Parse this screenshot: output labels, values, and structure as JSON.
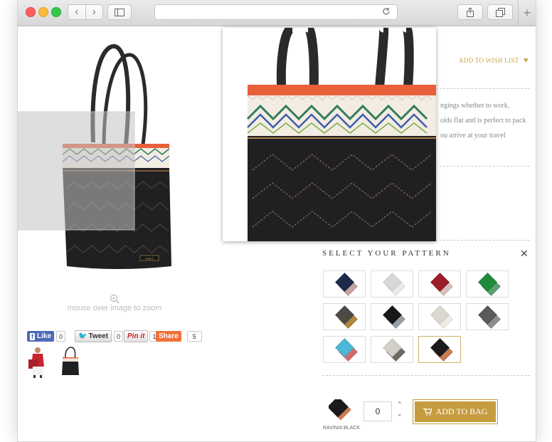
{
  "product": {
    "zoom_hint": "mouse over image to zoom",
    "add_to_wishlist": "ADD TO WISH LIST",
    "description": [
      "ngings whether to work,",
      "olds flat and is perfect to pack",
      "ou arrive at your travel"
    ],
    "tag_label": "cinda b"
  },
  "social": {
    "like_label": "Like",
    "like_count": "0",
    "tweet_label": "Tweet",
    "tweet_count": "0",
    "pin_label": "Pin it",
    "pin_count": "1",
    "share_label": "Share",
    "share_count": "5"
  },
  "patterns": {
    "title": "SELECT YOUR PATTERN",
    "close_glyph": "✕",
    "swatches": [
      {
        "a": "#1f2a4a",
        "b": "#c6a3a0"
      },
      {
        "a": "#d8d8d6",
        "b": "#ebebea"
      },
      {
        "a": "#9c1c2a",
        "b": "#d4c2bd"
      },
      {
        "a": "#1f8a3b",
        "b": "#5ca070"
      },
      {
        "a": "#4d4a46",
        "b": "#b0863c"
      },
      {
        "a": "#181818",
        "b": "#9aa0a8"
      },
      {
        "a": "#dcd8cf",
        "b": "#efece6"
      },
      {
        "a": "#5a5a5a",
        "b": "#8e8e8e"
      },
      {
        "a": "#4fb7d6",
        "b": "#cf6d6d"
      },
      {
        "a": "#d2d0c8",
        "b": "#6c6a5f"
      },
      {
        "a": "#1a1a1a",
        "b": "#c97b57"
      }
    ],
    "selected_index": 10
  },
  "cart": {
    "selected_pattern_name": "RAVINIA BLACK",
    "quantity": "0",
    "add_to_bag": "ADD TO BAG"
  },
  "colors": {
    "gold": "#c79c3f",
    "bag_black": "#202022",
    "trim_orange": "#e8603a"
  }
}
